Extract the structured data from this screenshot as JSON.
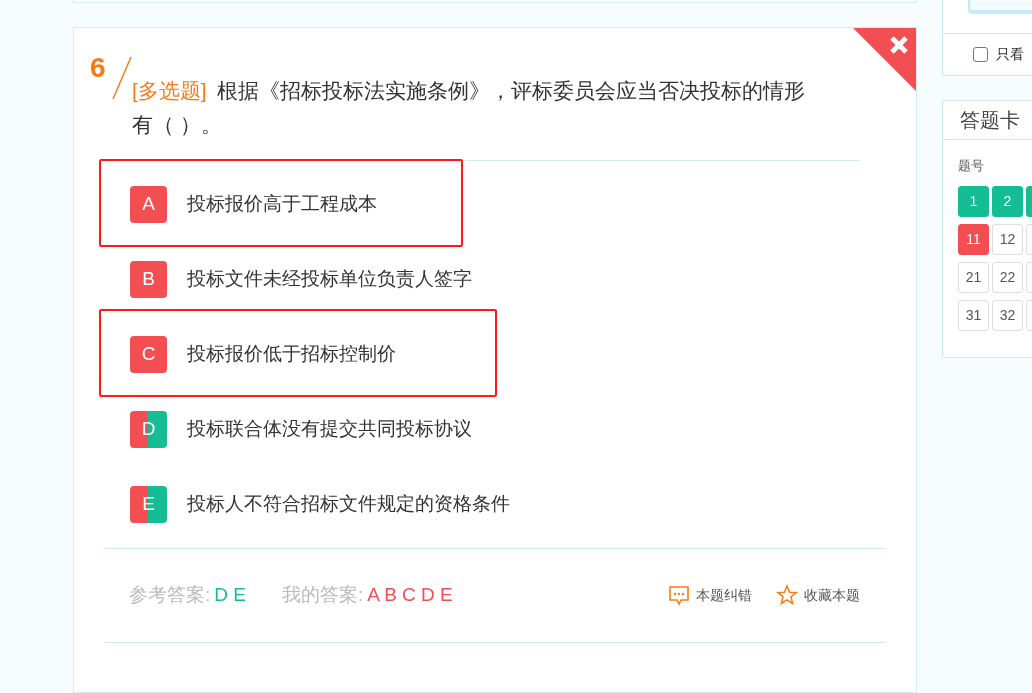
{
  "question": {
    "number": "6",
    "type_tag": "[多选题]",
    "text": "根据《招标投标法实施条例》，评标委员会应当否决投标的情形有（ ）。",
    "options": [
      {
        "letter": "A",
        "text": "投标报价高于工程成本",
        "kind": "wrong",
        "highlighted": true
      },
      {
        "letter": "B",
        "text": "投标文件未经投标单位负责人签字",
        "kind": "wrong",
        "highlighted": false
      },
      {
        "letter": "C",
        "text": "投标报价低于招标控制价",
        "kind": "wrong",
        "highlighted": true
      },
      {
        "letter": "D",
        "text": "投标联合体没有提交共同投标协议",
        "kind": "both",
        "highlighted": false
      },
      {
        "letter": "E",
        "text": "投标人不符合招标文件规定的资格条件",
        "kind": "both",
        "highlighted": false
      }
    ],
    "reference_label": "参考答案:",
    "reference_answer": "D E",
    "my_label": "我的答案:",
    "my_answer": "A B C D E",
    "actions": [
      {
        "kind": "report",
        "label": "本题纠错"
      },
      {
        "kind": "favorite",
        "label": "收藏本题"
      }
    ]
  },
  "sidebar": {
    "filter": {
      "label": "只看",
      "checked": false
    },
    "card_title": "答题卡",
    "column_label": "题号",
    "cells": [
      {
        "label": "1",
        "kind": "correct"
      },
      {
        "label": "2",
        "kind": "correct"
      },
      {
        "kind": "correct"
      },
      {
        "label": "11",
        "kind": "wrong"
      },
      {
        "label": "12",
        "kind": "blank"
      },
      {
        "kind": "blank"
      },
      {
        "label": "21",
        "kind": "blank"
      },
      {
        "label": "22",
        "kind": "blank"
      },
      {
        "kind": "blank"
      },
      {
        "label": "31",
        "kind": "blank"
      },
      {
        "label": "32",
        "kind": "blank"
      },
      {
        "kind": "blank"
      }
    ]
  }
}
